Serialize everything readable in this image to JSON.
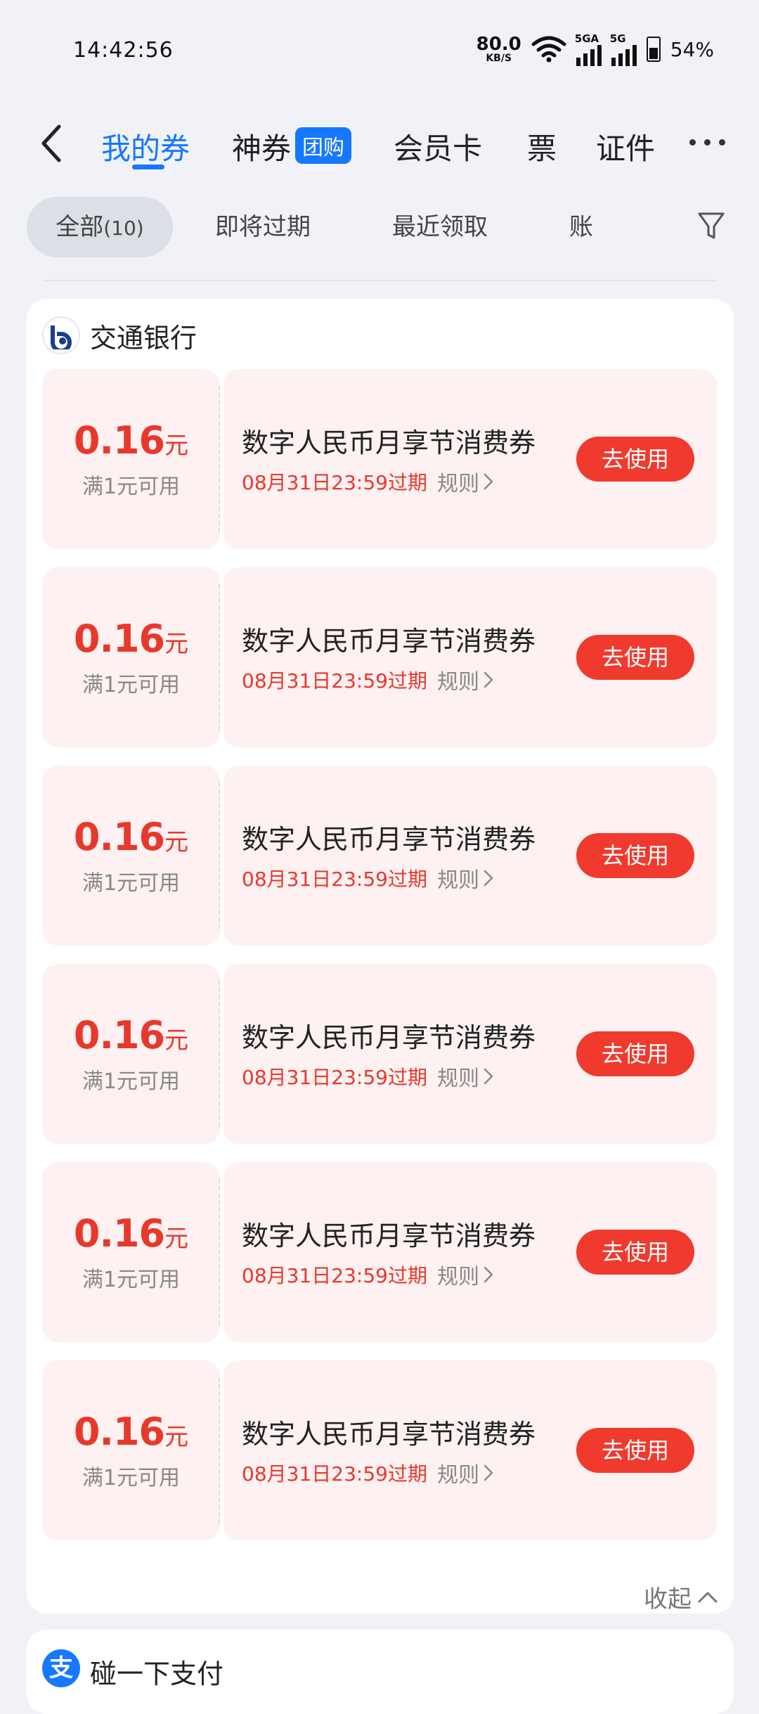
{
  "status_bar": {
    "time": "14:42:56",
    "net_speed_value": "80.0",
    "net_speed_unit": "KB/S",
    "signal1_tag": "5GA",
    "signal2_tag": "5G",
    "battery": "54%"
  },
  "nav": {
    "tabs": [
      {
        "label": "我的券",
        "active": true
      },
      {
        "label": "神券",
        "badge": "团购"
      },
      {
        "label": "会员卡"
      },
      {
        "label": "票"
      },
      {
        "label": "证件"
      }
    ]
  },
  "filters": {
    "all_label": "全部",
    "all_count": "(10)",
    "items": [
      "即将过期",
      "最近领取",
      "账"
    ]
  },
  "merchant": {
    "name": "交通银行",
    "coupons": [
      {
        "amount": "0.16",
        "unit": "元",
        "threshold": "满1元可用",
        "title": "数字人民币月享节消费券",
        "expiry": "08月31日23:59过期",
        "rules": "规则",
        "button": "去使用"
      },
      {
        "amount": "0.16",
        "unit": "元",
        "threshold": "满1元可用",
        "title": "数字人民币月享节消费券",
        "expiry": "08月31日23:59过期",
        "rules": "规则",
        "button": "去使用"
      },
      {
        "amount": "0.16",
        "unit": "元",
        "threshold": "满1元可用",
        "title": "数字人民币月享节消费券",
        "expiry": "08月31日23:59过期",
        "rules": "规则",
        "button": "去使用"
      },
      {
        "amount": "0.16",
        "unit": "元",
        "threshold": "满1元可用",
        "title": "数字人民币月享节消费券",
        "expiry": "08月31日23:59过期",
        "rules": "规则",
        "button": "去使用"
      },
      {
        "amount": "0.16",
        "unit": "元",
        "threshold": "满1元可用",
        "title": "数字人民币月享节消费券",
        "expiry": "08月31日23:59过期",
        "rules": "规则",
        "button": "去使用"
      },
      {
        "amount": "0.16",
        "unit": "元",
        "threshold": "满1元可用",
        "title": "数字人民币月享节消费券",
        "expiry": "08月31日23:59过期",
        "rules": "规则",
        "button": "去使用"
      }
    ],
    "collapse_label": "收起"
  },
  "next_merchant": {
    "logo_char": "支",
    "name": "碰一下支付"
  },
  "colors": {
    "accent": "#1677ff",
    "coupon_red": "#e8382c",
    "button_red": "#f03a2e",
    "coupon_bg": "#fdf1f1"
  }
}
